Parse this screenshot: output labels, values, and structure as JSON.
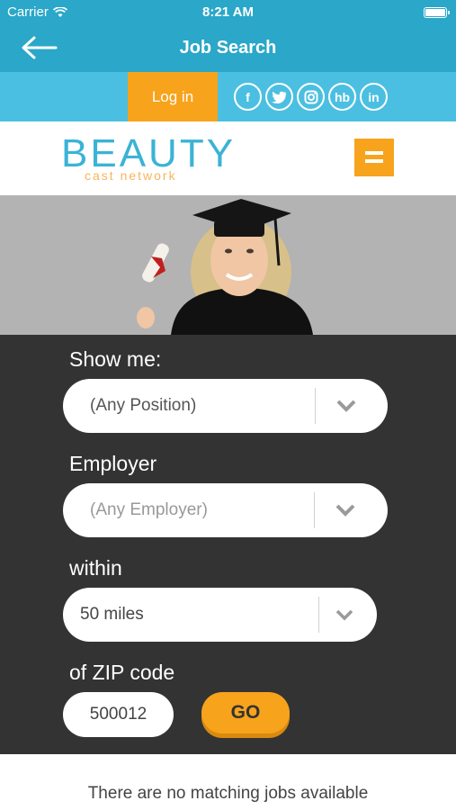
{
  "status_bar": {
    "carrier": "Carrier",
    "time": "8:21 AM"
  },
  "nav": {
    "title": "Job Search"
  },
  "top_bar": {
    "login_label": "Log in",
    "social": [
      "f",
      "t",
      "ig",
      "hb",
      "in"
    ]
  },
  "logo": {
    "title": "BEAUTY",
    "subtitle": "cast network"
  },
  "form": {
    "position_label": "Show me:",
    "position_value": "(Any Position)",
    "employer_label": "Employer",
    "employer_value": "(Any Employer)",
    "distance_label": "within",
    "distance_value": "50 miles",
    "zip_label": "of ZIP code",
    "zip_value": "500012",
    "go_label": "GO"
  },
  "results": {
    "message": "There are no matching jobs available"
  },
  "colors": {
    "header_blue": "#2aa7c9",
    "social_bar_blue": "#4bbfe1",
    "accent_orange": "#f7a31c",
    "panel_dark": "#333333"
  }
}
